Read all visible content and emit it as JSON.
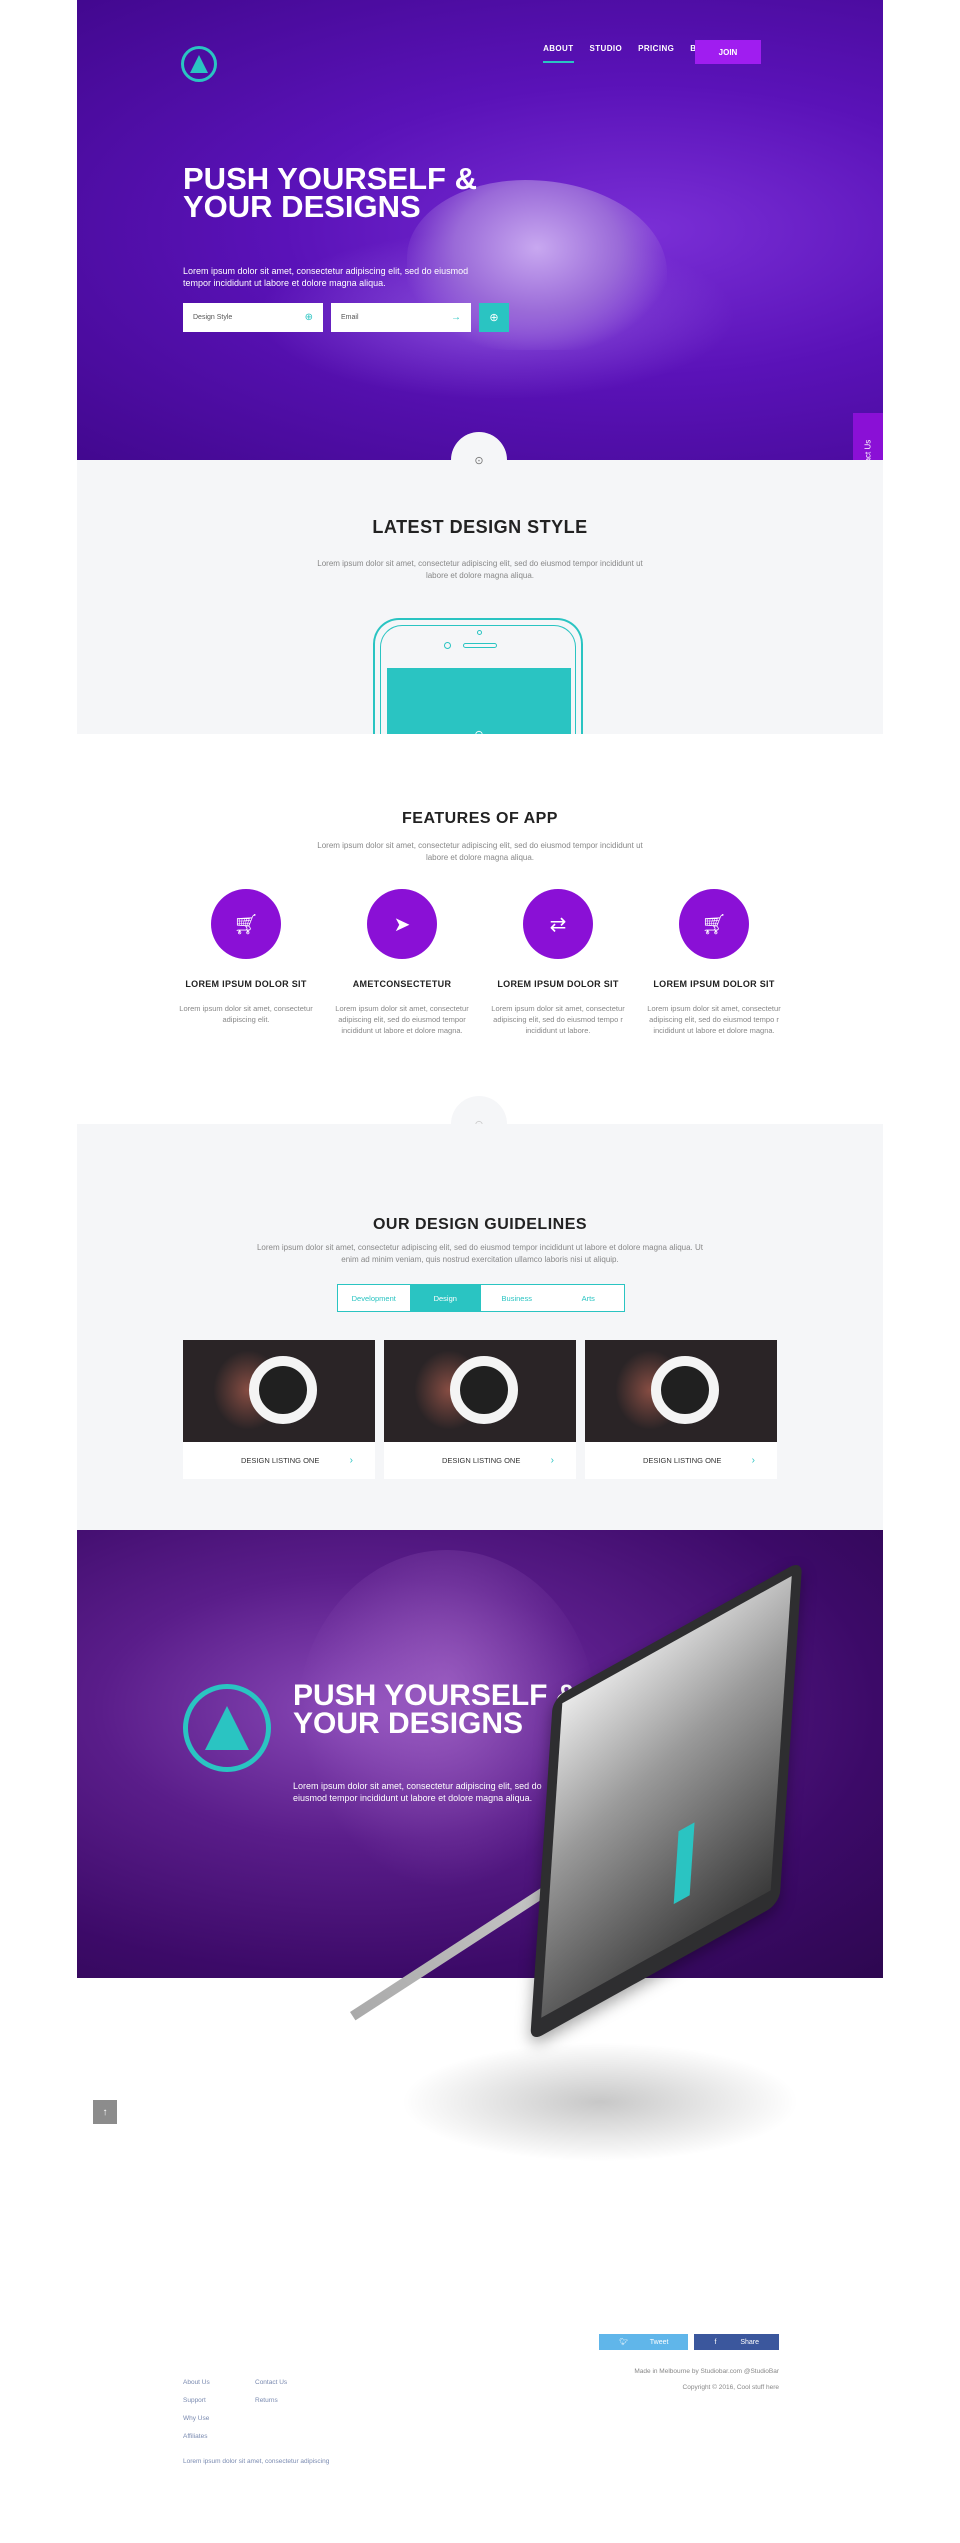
{
  "nav": {
    "items": [
      "ABOUT",
      "STUDIO",
      "PRICING",
      "BLOG"
    ],
    "join": "JOIN"
  },
  "hero": {
    "title": "PUSH YOURSELF & YOUR DESIGNS",
    "lead": "Lorem ipsum dolor sit amet, consectetur adipiscing elit, sed do eiusmod tempor incididunt ut labore et dolore magna aliqua.",
    "field1": "Design Style",
    "field2": "Email"
  },
  "contact_tab": "Contact Us",
  "latest": {
    "title": "LATEST DESIGN STYLE",
    "text": "Lorem ipsum dolor sit amet, consectetur adipiscing elit, sed do eiusmod tempor incididunt ut labore et dolore magna aliqua."
  },
  "features": {
    "title": "FEATURES OF APP",
    "text": "Lorem ipsum dolor sit amet, consectetur adipiscing elit, sed do eiusmod tempor incididunt ut labore et dolore magna aliqua.",
    "items": [
      {
        "icon": "cart-icon",
        "title": "LOREM IPSUM DOLOR SIT",
        "text": "Lorem ipsum dolor sit amet, consectetur adipiscing elit."
      },
      {
        "icon": "paper-plane-icon",
        "title": "AMETCONSECTETUR",
        "text": "Lorem ipsum dolor sit amet, consectetur adipiscing elit, sed do eiusmod tempor incididunt ut labore et dolore magna."
      },
      {
        "icon": "swap-icon",
        "title": "LOREM IPSUM DOLOR SIT",
        "text": "Lorem ipsum dolor sit amet, consectetur adipiscing elit, sed do eiusmod tempo r incididunt ut labore."
      },
      {
        "icon": "cart-icon",
        "title": "LOREM IPSUM DOLOR SIT",
        "text": "Lorem ipsum dolor sit amet, consectetur adipiscing elit, sed do eiusmod tempo r incididunt ut labore et dolore magna."
      }
    ]
  },
  "guide": {
    "title": "OUR DESIGN GUIDELINES",
    "text": "Lorem ipsum dolor sit amet, consectetur adipiscing elit, sed do eiusmod tempor incididunt ut labore et dolore magna aliqua. Ut enim ad minim veniam, quis nostrud exercitation ullamco laboris nisi ut aliquip.",
    "tabs": [
      "Development",
      "Design",
      "Business",
      "Arts"
    ],
    "active_tab": "Design",
    "cards": [
      "DESIGN LISTING ONE",
      "DESIGN LISTING ONE",
      "DESIGN LISTING ONE"
    ]
  },
  "promo": {
    "title": "PUSH YOURSELF & YOUR DESIGNS",
    "text": "Lorem ipsum dolor sit amet, consectetur adipiscing elit, sed do eiusmod tempor incididunt ut labore et dolore magna aliqua."
  },
  "footer": {
    "tweet": "Tweet",
    "share": "Share",
    "made": "Made in Melbourne by Studiobar.com @StudioBar",
    "copyright": "Copyright © 2016, Cool stuff here",
    "col1": [
      "About Us",
      "Support",
      "Why Use",
      "Affiliates"
    ],
    "col2": [
      "Contact Us",
      "Returns"
    ],
    "tagline": "Lorem ipsum dolor sit amet, consectetur adipiscing"
  },
  "colors": {
    "accent": "#2ac4c2",
    "purple": "#8a10d6"
  }
}
